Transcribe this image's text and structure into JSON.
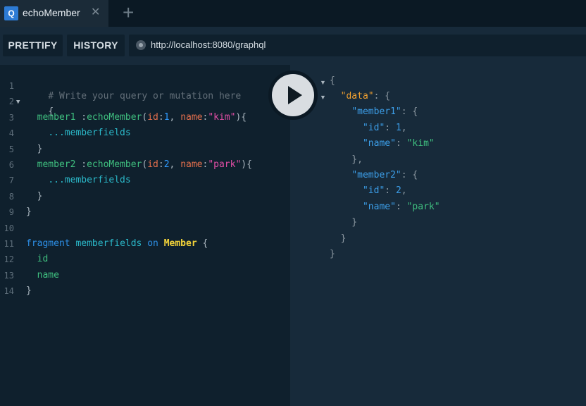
{
  "tab": {
    "badge": "Q",
    "title": "echoMember",
    "close": "✕",
    "add": "+"
  },
  "toolbar": {
    "prettify_label": "PRETTIFY",
    "history_label": "HISTORY",
    "url": "http://localhost:8080/graphql"
  },
  "editor": {
    "line_numbers": [
      "1",
      "2",
      "3",
      "4",
      "5",
      "6",
      "7",
      "8",
      "9",
      "10",
      "11",
      "12",
      "13",
      "14"
    ],
    "comment": "# Write your query or mutation here",
    "brace_open": "{",
    "brace_close": "}",
    "member1": {
      "alias": "member1",
      "sep": " :",
      "field": "echoMember",
      "id_arg": "id",
      "id_val": "1",
      "name_arg": "name",
      "name_val": "\"kim\""
    },
    "member2": {
      "alias": "member2",
      "sep": " :",
      "field": "echoMember",
      "id_arg": "id",
      "id_val": "2",
      "name_arg": "name",
      "name_val": "\"park\""
    },
    "spread": "...memberfields",
    "fragment": {
      "kw": "fragment",
      "name": "memberfields",
      "on": "on",
      "type": "Member"
    },
    "fields": [
      "id",
      "name"
    ]
  },
  "result": {
    "data_key": "\"data\"",
    "member1_key": "\"member1\"",
    "member2_key": "\"member2\"",
    "id_key": "\"id\"",
    "name_key": "\"name\"",
    "m1_id": "1",
    "m1_name": "\"kim\"",
    "m2_id": "2",
    "m2_name": "\"park\""
  }
}
